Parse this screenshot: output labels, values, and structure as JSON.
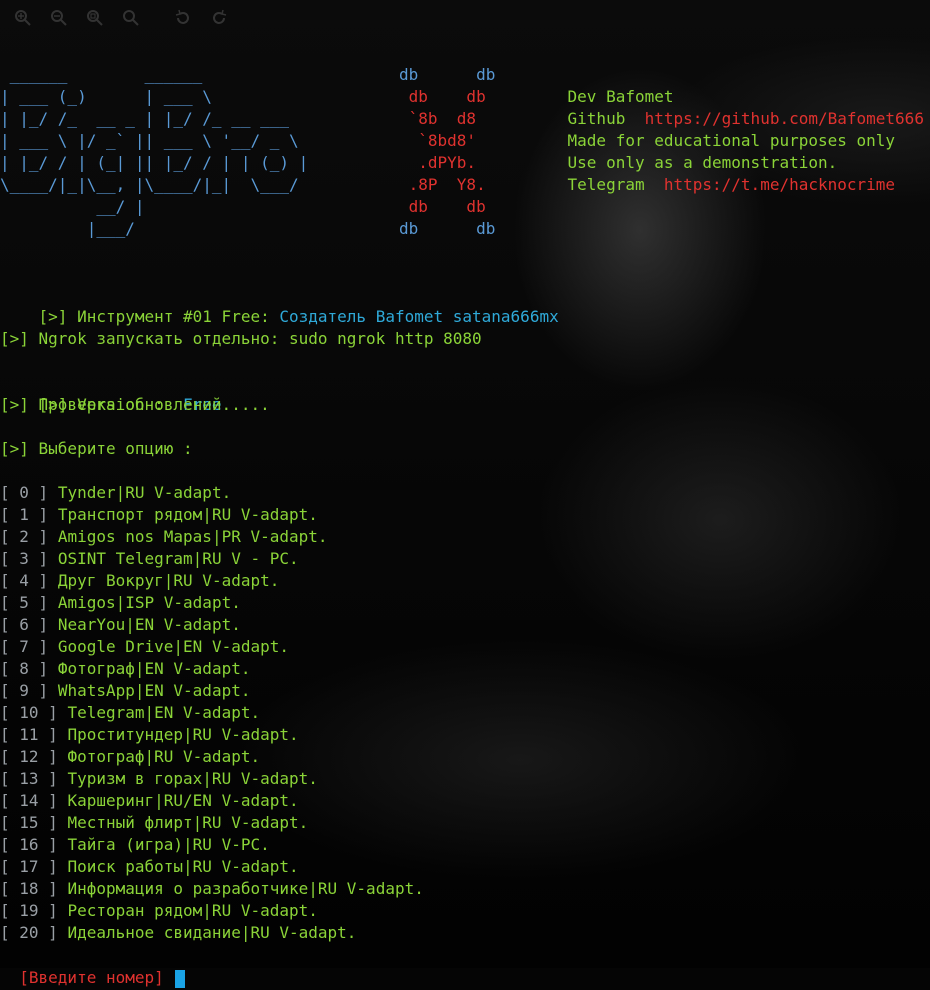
{
  "toolbar": {
    "icons": [
      "zoom-in-icon",
      "zoom-out-icon",
      "zoom-fit-icon",
      "search-icon",
      "rotate-left-icon",
      "rotate-right-icon"
    ]
  },
  "banner": {
    "art": [
      " ______        ______",
      "| ___ (_)      | ___ \\",
      "| |_/ /_  __ _ | |_/ /_ __ ___",
      "| ___ \\ |/ _` || ___ \\ '__/ _ \\",
      "| |_/ / | (_| || |_/ / | | (_) |",
      "\\____/|_|\\__, |\\____/|_|  \\___/",
      "          __/ |",
      "         |___/"
    ],
    "x_mark": [
      "db      db",
      " db    db",
      " `8b  d8",
      "  `8bd8'",
      "  .dPYb.",
      " .8P  Y8.",
      " db    db",
      "db      db"
    ],
    "info": [
      {
        "label": "Dev Bafomet",
        "value": ""
      },
      {
        "label": "Github",
        "value": "https://github.com/Bafomet666"
      },
      {
        "label": "Made for educational purposes only",
        "value": ""
      },
      {
        "label": "Use only as a demonstration.",
        "value": ""
      },
      {
        "label": "Telegram",
        "value": "https://t.me/hacknocrime"
      }
    ]
  },
  "messages": {
    "tool_prefix": "[>] Инструмент #01 Free: ",
    "tool_author": "Создатель Bafomet satana666mx",
    "ngrok": "[>] Ngrok запускать отдельно: sudo ngrok http 8080",
    "version_prefix": "[>] Version :  ",
    "version_value": "Free",
    "updates": "[>] Проверка обновлений.....",
    "choose": "[>] Выберите опцию :"
  },
  "options": [
    {
      "num": "[ 0 ]",
      "label": "Tynder|RU V-adapt."
    },
    {
      "num": "[ 1 ]",
      "label": "Транспорт рядом|RU V-adapt."
    },
    {
      "num": "[ 2 ]",
      "label": "Amigos nos Mapas|PR V-adapt."
    },
    {
      "num": "[ 3 ]",
      "label": "OSINT Telegram|RU V - PC."
    },
    {
      "num": "[ 4 ]",
      "label": "Друг Вокруг|RU V-adapt."
    },
    {
      "num": "[ 5 ]",
      "label": "Amigos|ISP V-adapt."
    },
    {
      "num": "[ 6 ]",
      "label": "NearYou|EN V-adapt."
    },
    {
      "num": "[ 7 ]",
      "label": "Google Drive|EN V-adapt."
    },
    {
      "num": "[ 8 ]",
      "label": "Фотограф|EN V-adapt."
    },
    {
      "num": "[ 9 ]",
      "label": "WhatsApp|EN V-adapt."
    },
    {
      "num": "[ 10 ]",
      "label": "Telegram|EN V-adapt."
    },
    {
      "num": "[ 11 ]",
      "label": "Проститундер|RU V-adapt."
    },
    {
      "num": "[ 12 ]",
      "label": "Фотограф|RU V-adapt."
    },
    {
      "num": "[ 13 ]",
      "label": "Туризм в горах|RU V-adapt."
    },
    {
      "num": "[ 14 ]",
      "label": "Каршеринг|RU/EN V-adapt."
    },
    {
      "num": "[ 15 ]",
      "label": "Местный флирт|RU V-adapt."
    },
    {
      "num": "[ 16 ]",
      "label": "Тайга (игра)|RU V-PC."
    },
    {
      "num": "[ 17 ]",
      "label": "Поиск работы|RU V-adapt."
    },
    {
      "num": "[ 18 ]",
      "label": "Информация о разработчике|RU V-adapt."
    },
    {
      "num": "[ 19 ]",
      "label": "Ресторан рядом|RU V-adapt."
    },
    {
      "num": "[ 20 ]",
      "label": "Идеальное свидание|RU V-adapt."
    }
  ],
  "prompt": {
    "label": "[Введите номер]"
  },
  "colors": {
    "banner": "#6fa7d9",
    "red": "#e0322f",
    "green": "#8bd438",
    "cyan": "#2fa9d8",
    "cursor": "#1aa3e6"
  }
}
